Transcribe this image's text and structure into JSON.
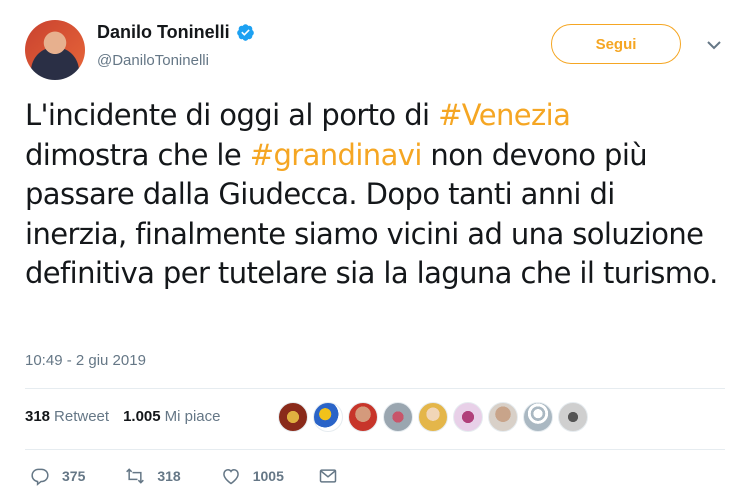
{
  "user": {
    "name": "Danilo Toninelli",
    "handle": "@DaniloToninelli",
    "follow_label": "Segui"
  },
  "tweet": {
    "seg1": "L'incidente di oggi al porto di ",
    "hashtag1": "#Venezia",
    "seg2": "dimostra che le ",
    "hashtag2": "#grandinavi",
    "seg3": " non devono più passare dalla Giudecca. Dopo tanti anni di inerzia, finalmente siamo vicini ad una soluzione definitiva per tutelare sia la laguna che il turismo.",
    "timestamp": "10:49 - 2 giu 2019"
  },
  "stats": {
    "retweets": "318",
    "retweets_label": "Retweet",
    "likes": "1.005",
    "likes_label": "Mi piace"
  },
  "actions": {
    "replies": "375",
    "retweets": "318",
    "likes": "1005"
  },
  "colors": {
    "accent": "#f5a623",
    "verified": "#1da1f2",
    "muted": "#657786"
  }
}
